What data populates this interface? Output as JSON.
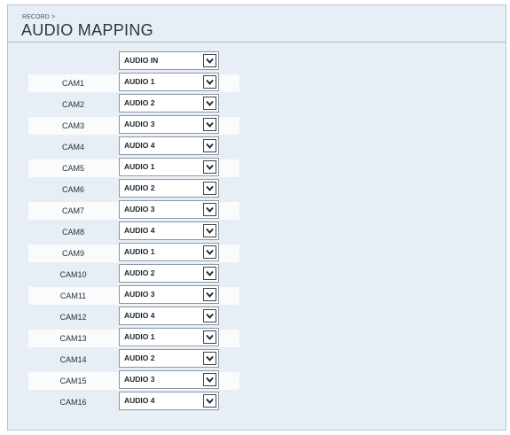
{
  "breadcrumb": "RECORD >",
  "title": "AUDIO MAPPING",
  "header_select": {
    "value": "AUDIO IN",
    "icon": "chevron-down-icon"
  },
  "rows": [
    {
      "camera": "CAM1",
      "audio": "AUDIO 1"
    },
    {
      "camera": "CAM2",
      "audio": "AUDIO 2"
    },
    {
      "camera": "CAM3",
      "audio": "AUDIO 3"
    },
    {
      "camera": "CAM4",
      "audio": "AUDIO 4"
    },
    {
      "camera": "CAM5",
      "audio": "AUDIO 1"
    },
    {
      "camera": "CAM6",
      "audio": "AUDIO 2"
    },
    {
      "camera": "CAM7",
      "audio": "AUDIO 3"
    },
    {
      "camera": "CAM8",
      "audio": "AUDIO 4"
    },
    {
      "camera": "CAM9",
      "audio": "AUDIO 1"
    },
    {
      "camera": "CAM10",
      "audio": "AUDIO 2"
    },
    {
      "camera": "CAM11",
      "audio": "AUDIO 3"
    },
    {
      "camera": "CAM12",
      "audio": "AUDIO 4"
    },
    {
      "camera": "CAM13",
      "audio": "AUDIO 1"
    },
    {
      "camera": "CAM14",
      "audio": "AUDIO 2"
    },
    {
      "camera": "CAM15",
      "audio": "AUDIO 3"
    },
    {
      "camera": "CAM16",
      "audio": "AUDIO 4"
    }
  ],
  "colors": {
    "background": "#e7eef5",
    "stripe": "#f9fbfd",
    "border": "#8b97a3"
  }
}
